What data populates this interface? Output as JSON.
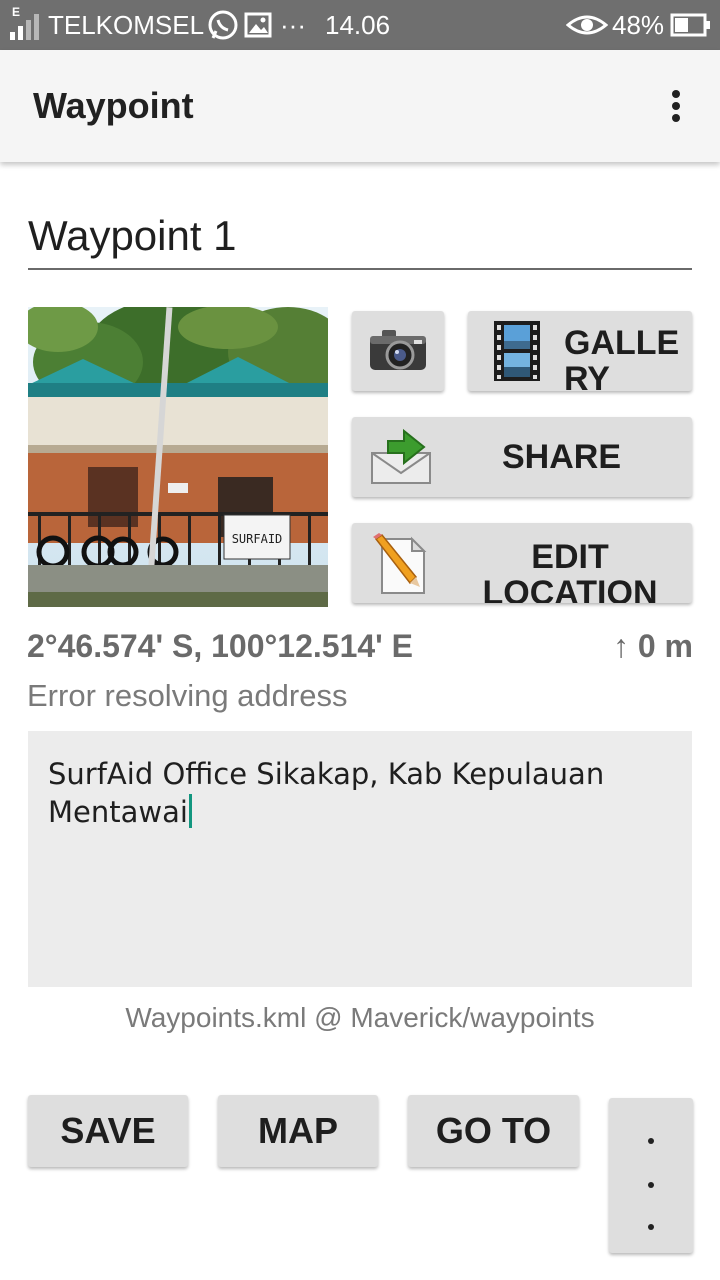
{
  "status_bar": {
    "carrier": "TELKOMSEL",
    "network_label": "E",
    "more_notifications": "···",
    "time": "14.06",
    "battery": "48%",
    "battery_level": 0.48
  },
  "app_bar": {
    "title": "Waypoint"
  },
  "waypoint": {
    "name": "Waypoint 1",
    "coordinates": "2°46.574' S, 100°12.514' E",
    "altitude": "↑ 0 m",
    "address_status": "Error resolving address",
    "notes": "SurfAid Office Sikakap, Kab Kepulauan Mentawai",
    "file_location": "Waypoints.kml @ Maverick/waypoints",
    "photo_sign_text": "SURFAID"
  },
  "actions": {
    "gallery": "GALLERY",
    "share": "SHARE",
    "edit_location": "EDIT LOCATION",
    "save": "SAVE",
    "map": "MAP",
    "goto": "GO TO"
  },
  "icons": {
    "camera": "camera-icon",
    "gallery": "film-strip-icon",
    "share": "envelope-arrow-icon",
    "edit_location": "pencil-document-icon",
    "overflow": "vertical-dots-icon",
    "more": "vertical-dots-icon"
  },
  "colors": {
    "status_bar": "#6f6f6f",
    "app_bar": "#f5f5f5",
    "button": "#dedede",
    "cursor": "#12967f"
  }
}
